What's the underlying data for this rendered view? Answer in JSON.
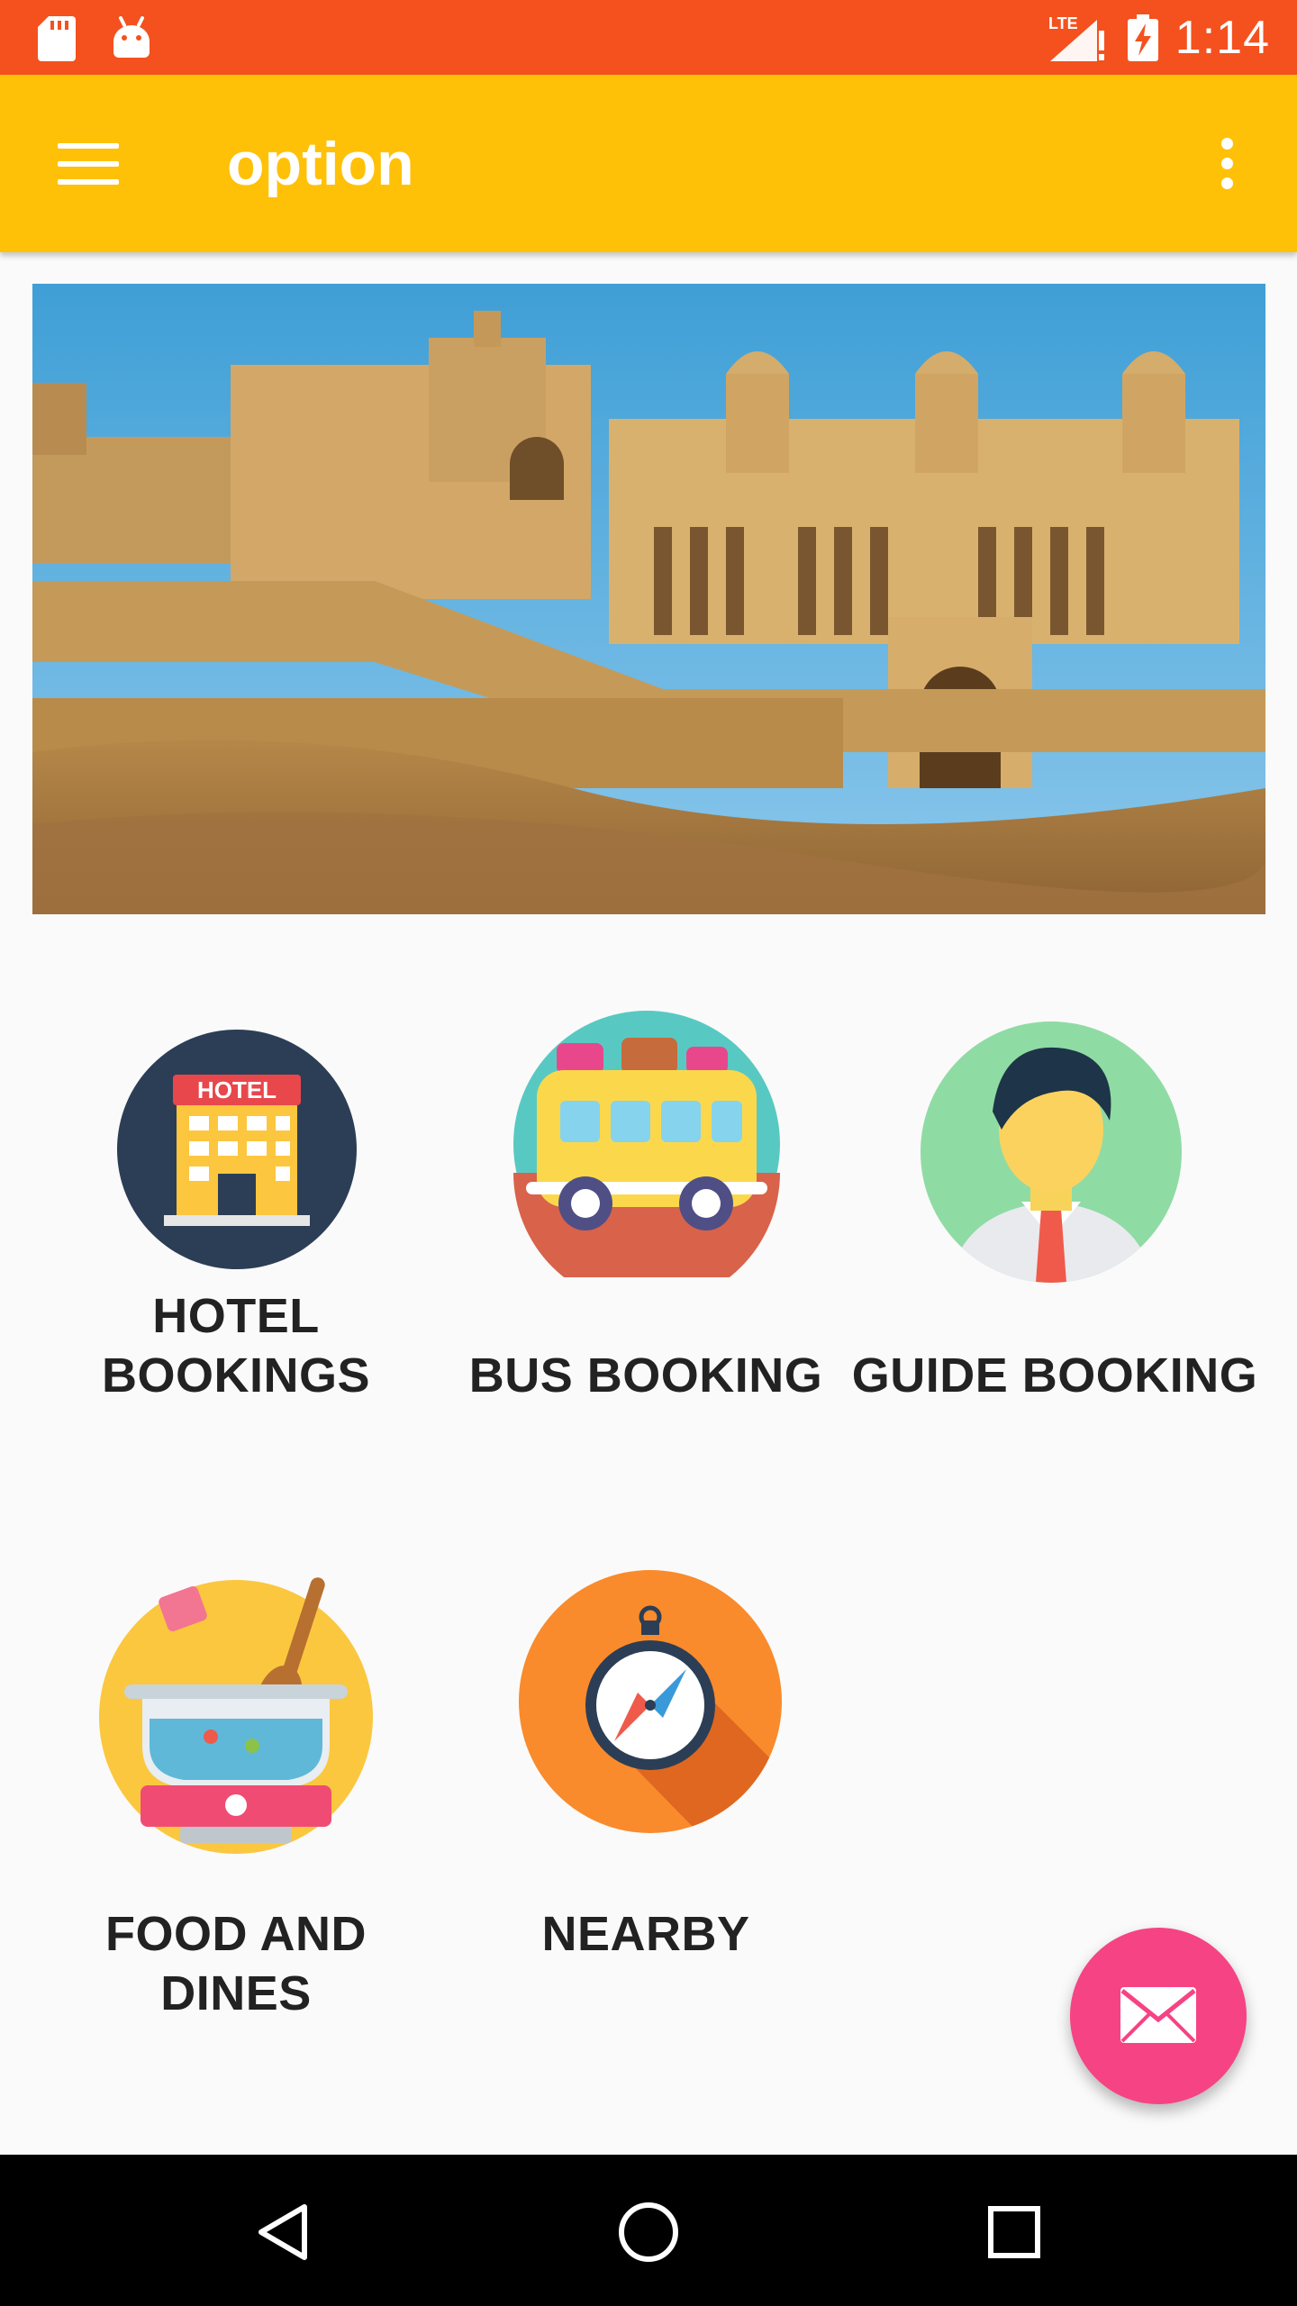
{
  "status_bar": {
    "time": "1:14",
    "network": "LTE",
    "icons": [
      "sd-card-icon",
      "android-icon",
      "signal-icon",
      "battery-charging-icon"
    ]
  },
  "app_bar": {
    "title": "option",
    "menu_icon": "menu-icon",
    "overflow_icon": "more-vert-icon"
  },
  "banner": {
    "image": "amber-fort-photo"
  },
  "tiles": [
    {
      "label": "HOTEL\nBOOKINGS",
      "icon": "hotel-icon",
      "badge_text": "HOTEL"
    },
    {
      "label": "BUS BOOKING",
      "icon": "bus-icon"
    },
    {
      "label": "GUIDE BOOKING",
      "icon": "guide-icon"
    },
    {
      "label": "FOOD AND DINES",
      "icon": "food-icon"
    },
    {
      "label": "NEARBY",
      "icon": "compass-icon"
    }
  ],
  "fab": {
    "icon": "mail-icon"
  },
  "nav_bar": {
    "icons": [
      "back-icon",
      "home-icon",
      "recents-icon"
    ]
  },
  "colors": {
    "status_bar": "#f4511e",
    "app_bar": "#ffc107",
    "fab": "#f64384",
    "background": "#fafafa"
  }
}
